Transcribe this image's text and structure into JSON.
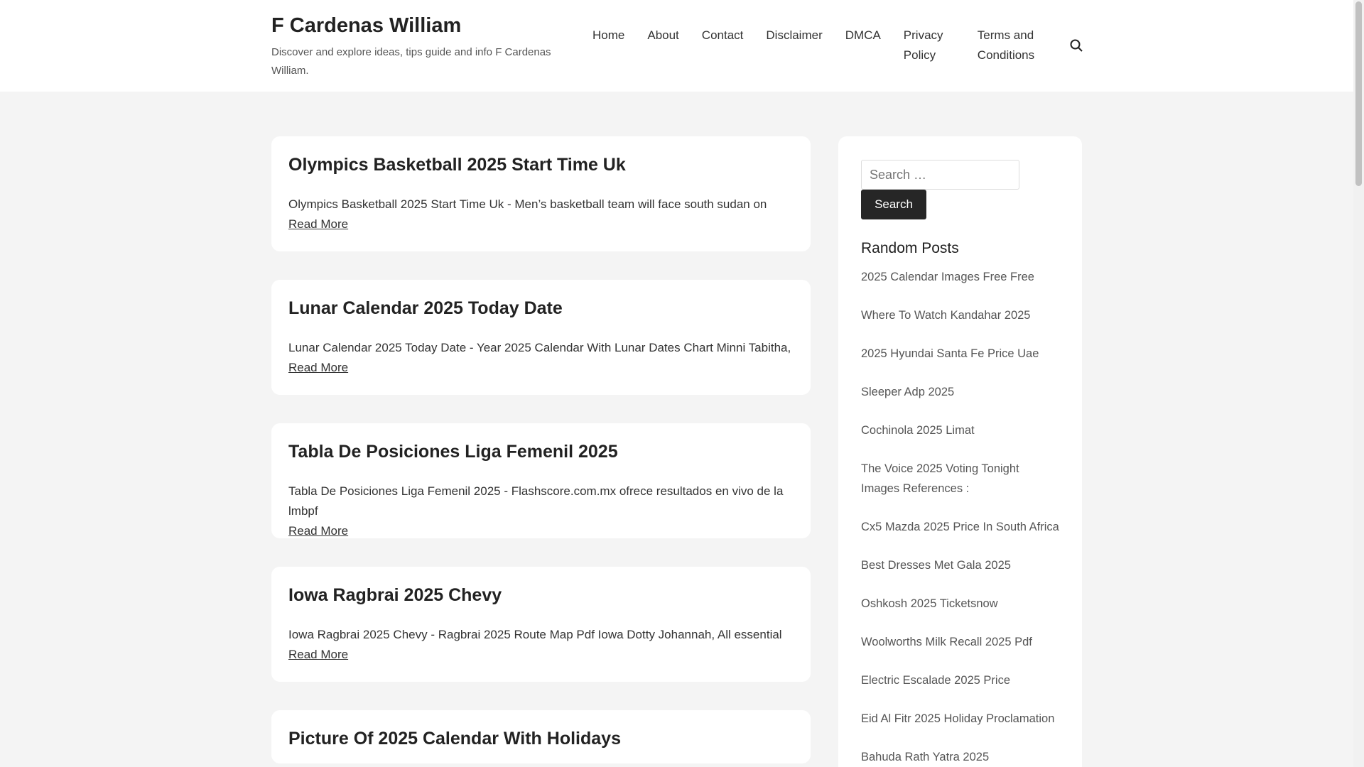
{
  "header": {
    "title": "F Cardenas William",
    "tagline": "Discover and explore ideas, tips guide and info F Cardenas William."
  },
  "nav": [
    "Home",
    "About",
    "Contact",
    "Disclaimer",
    "DMCA",
    "Privacy Policy",
    "Terms and Conditions"
  ],
  "posts": [
    {
      "title": "Olympics Basketball 2025 Start Time Uk",
      "excerpt": "Olympics Basketball 2025 Start Time Uk - Men’s basketball team will face south sudan on",
      "link": "Read More"
    },
    {
      "title": "Lunar Calendar 2025 Today Date",
      "excerpt": "Lunar Calendar 2025 Today Date - Year 2025 Calendar With Lunar Dates Chart Minni Tabitha,",
      "link": "Read More"
    },
    {
      "title": "Tabla De Posiciones Liga Femenil 2025",
      "excerpt": "Tabla De Posiciones Liga Femenil 2025 - Flashscore.com.mx ofrece resultados en vivo de la lmbpf",
      "link": "Read More"
    },
    {
      "title": "Iowa Ragbrai 2025 Chevy",
      "excerpt": "Iowa Ragbrai 2025 Chevy - Ragbrai 2025 Route Map Pdf Iowa Dotty Johannah, All essential",
      "link": "Read More"
    },
    {
      "title": "Picture Of 2025 Calendar With Holidays"
    }
  ],
  "sidebar": {
    "search_placeholder": "Search …",
    "search_button": "Search",
    "widget_title": "Random Posts",
    "random_posts": [
      "2025 Calendar Images Free Free",
      "Where To Watch Kandahar 2025",
      "2025 Hyundai Santa Fe Price Uae",
      "Sleeper Adp 2025",
      "Cochinola 2025 Limat",
      "The Voice 2025 Voting Tonight Images References :",
      "Cx5 Mazda 2025 Price In South Africa",
      "Best Dresses Met Gala 2025",
      "Oshkosh 2025 Ticketsnow",
      "Woolworths Milk Recall 2025 Pdf",
      "Electric Escalade 2025 Price",
      "Eid Al Fitr 2025 Holiday Proclamation",
      "Bahuda Rath Yatra 2025"
    ]
  }
}
